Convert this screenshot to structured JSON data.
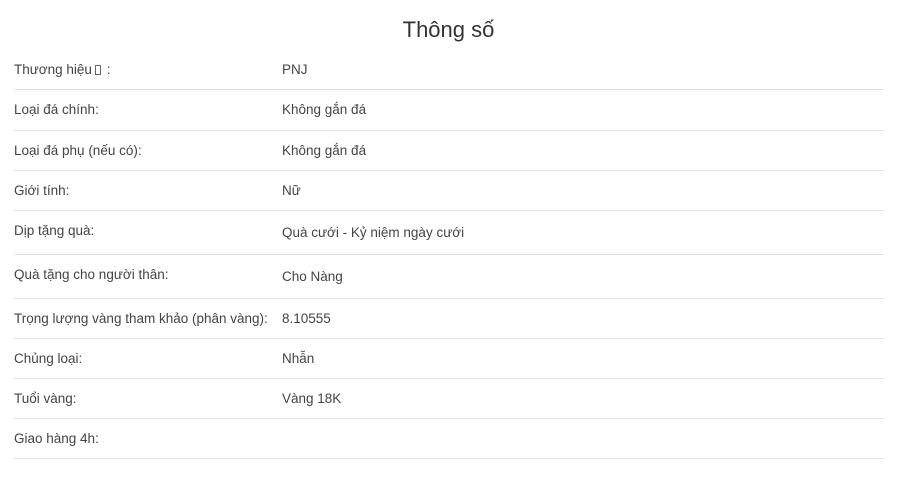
{
  "title": "Thông số",
  "rows": [
    {
      "label": "Thương hiệu",
      "label_suffix": " :",
      "value": "PNJ"
    },
    {
      "label": "Loại đá chính:",
      "value": "Không gắn đá"
    },
    {
      "label": "Loại đá phụ (nếu có):",
      "value": "Không gắn đá"
    },
    {
      "label": "Giới tính:",
      "value": "Nữ"
    },
    {
      "label": "Dịp tặng quà:",
      "value": "Quà cưới - Kỷ niệm ngày cưới"
    },
    {
      "label": "Quà tặng cho người thân:",
      "value": "Cho Nàng"
    },
    {
      "label": "Trọng lượng vàng tham khảo (phân vàng):",
      "value": "8.10555"
    },
    {
      "label": "Chủng loại:",
      "value": "Nhẫn"
    },
    {
      "label": "Tuổi vàng:",
      "value": "Vàng 18K"
    },
    {
      "label": "Giao hàng 4h:",
      "value": ""
    }
  ]
}
